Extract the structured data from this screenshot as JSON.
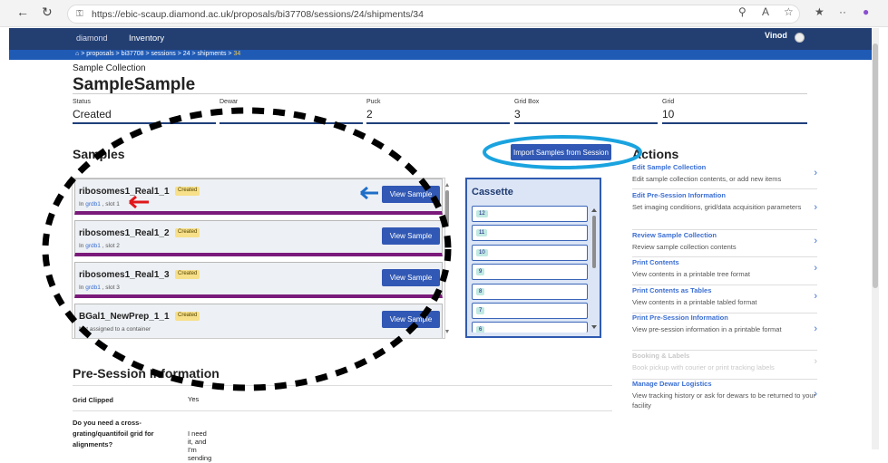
{
  "browser": {
    "url": "https://ebic-scaup.diamond.ac.uk/proposals/bi37708/sessions/24/shipments/34"
  },
  "navbar": {
    "logo": "diamond",
    "inventory": "Inventory",
    "user": "Vinod"
  },
  "breadcrumb": {
    "items": [
      "proposals",
      ">",
      "bi37708",
      ">",
      "sessions",
      ">",
      "24",
      ">",
      "shipments",
      ">"
    ],
    "current": "34"
  },
  "header": {
    "kicker": "Sample Collection",
    "title": "SampleSample"
  },
  "fields": [
    {
      "label": "Status",
      "value": "Created"
    },
    {
      "label": "Dewar",
      "value": ""
    },
    {
      "label": "Puck",
      "value": "2"
    },
    {
      "label": "Grid Box",
      "value": "3"
    },
    {
      "label": "Grid",
      "value": "10"
    }
  ],
  "samples": {
    "heading": "Samples",
    "import_label": "Import Samples from Session",
    "items": [
      {
        "name": "ribosomes1_Real1_1",
        "badge": "Created",
        "sub_pre": "In ",
        "container": "grdb1",
        "sub_post": " , slot 1",
        "view": "View Sample"
      },
      {
        "name": "ribosomes1_Real1_2",
        "badge": "Created",
        "sub_pre": "In ",
        "container": "grdb1",
        "sub_post": " , slot 2",
        "view": "View Sample"
      },
      {
        "name": "ribosomes1_Real1_3",
        "badge": "Created",
        "sub_pre": "In ",
        "container": "grdb1",
        "sub_post": " , slot 3",
        "view": "View Sample"
      },
      {
        "name": "BGal1_NewPrep_1_1",
        "badge": "Created",
        "sub_pre": "Not assigned to a container",
        "container": "",
        "sub_post": "",
        "view": "View Sample"
      }
    ]
  },
  "cassette": {
    "title": "Cassette",
    "slots": [
      "12",
      "11",
      "10",
      "9",
      "8",
      "7",
      "6"
    ]
  },
  "actions": {
    "heading": "Actions",
    "items": [
      {
        "title": "Edit Sample Collection",
        "desc": "Edit sample collection contents, or add new items",
        "enabled": true
      },
      {
        "title": "Edit Pre-Session Information",
        "desc": "Set imaging conditions, grid/data acquisition parameters",
        "enabled": true
      },
      {
        "title": "Review Sample Collection",
        "desc": "Review sample collection contents",
        "enabled": true
      },
      {
        "title": "Print Contents",
        "desc": "View contents in a printable tree format",
        "enabled": true
      },
      {
        "title": "Print Contents as Tables",
        "desc": "View contents in a printable tabled format",
        "enabled": true
      },
      {
        "title": "Print Pre-Session Information",
        "desc": "View pre-session information in a printable format",
        "enabled": true
      },
      {
        "title": "Booking & Labels",
        "desc": "Book pickup with courier or print tracking labels",
        "enabled": false
      },
      {
        "title": "Manage Dewar Logistics",
        "desc": "View tracking history or ask for dewars to be returned to your facility",
        "enabled": true
      }
    ]
  },
  "presession": {
    "heading": "Pre-Session Information",
    "rows": [
      {
        "key": "Grid Clipped",
        "value": "Yes"
      },
      {
        "key": "Do you need a cross-grating/quantifoil grid for alignments?",
        "value": "I need it, and I'm sending it myself"
      }
    ]
  },
  "colors": {
    "navbar": "#233f72",
    "breadcrumb": "#1f5ab5",
    "primary": "#3158b4",
    "accent_purple": "#7a1a7a",
    "annotation_cyan": "#1aa3df",
    "annotation_red": "#e0161b",
    "annotation_blue": "#1f6fc8"
  }
}
